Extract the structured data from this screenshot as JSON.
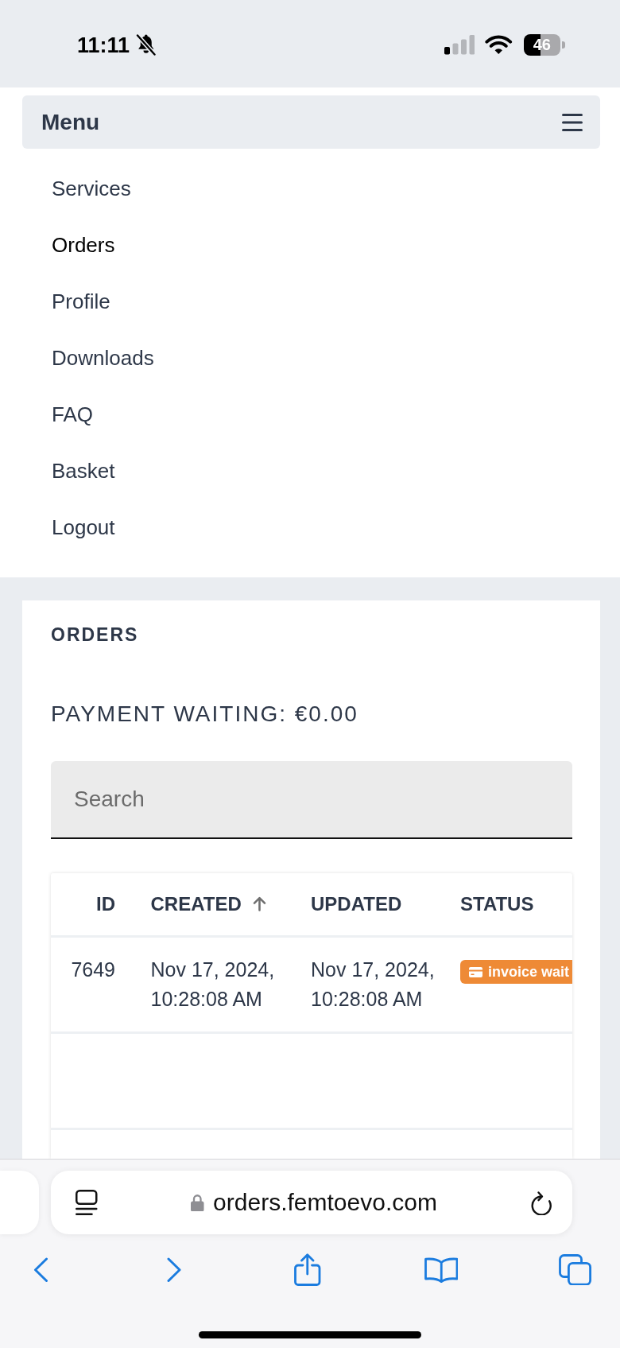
{
  "status_bar": {
    "time": "11:11",
    "battery": "46"
  },
  "menu": {
    "title": "Menu",
    "items": [
      {
        "label": "Services",
        "selected": false
      },
      {
        "label": "Orders",
        "selected": true
      },
      {
        "label": "Profile",
        "selected": false
      },
      {
        "label": "Downloads",
        "selected": false
      },
      {
        "label": "FAQ",
        "selected": false
      },
      {
        "label": "Basket",
        "selected": false
      },
      {
        "label": "Logout",
        "selected": false
      }
    ]
  },
  "orders": {
    "title": "ORDERS",
    "payment_waiting": "PAYMENT WAITING: €0.00",
    "search": {
      "placeholder": "Search"
    },
    "table": {
      "columns": [
        {
          "label": "ID",
          "sorted": false
        },
        {
          "label": "CREATED",
          "sorted": true
        },
        {
          "label": "UPDATED",
          "sorted": false
        },
        {
          "label": "STATUS",
          "sorted": false
        }
      ],
      "rows": [
        {
          "id": "7649",
          "created": "Nov 17, 2024, 10:28:08 AM",
          "updated": "Nov 17, 2024, 10:28:08 AM",
          "status": {
            "label": "invoice wait",
            "color": "#ee8a36"
          }
        }
      ]
    }
  },
  "browser": {
    "url": "orders.femtoevo.com"
  }
}
